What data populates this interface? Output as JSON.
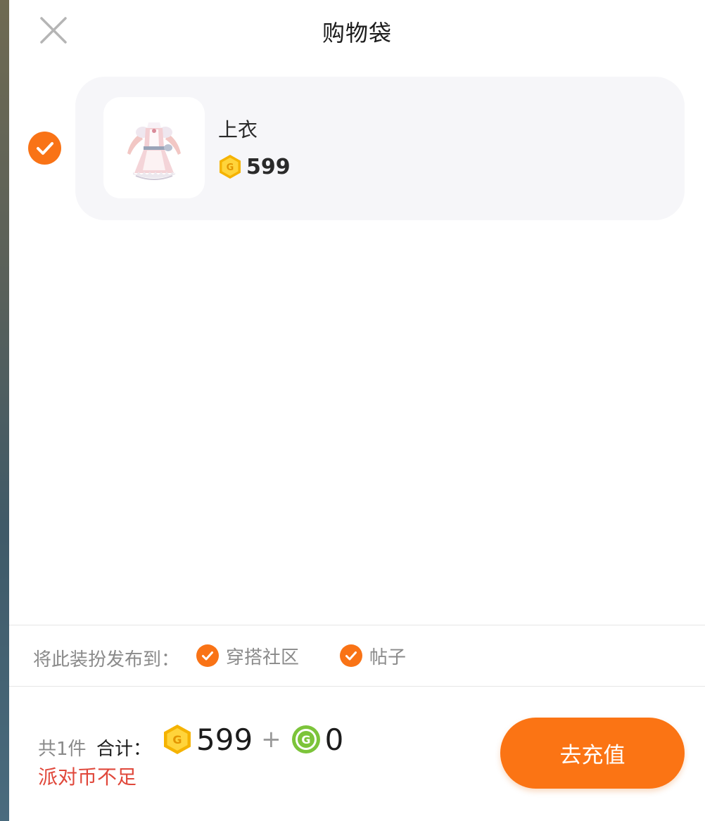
{
  "header": {
    "title": "购物袋",
    "close_icon": "close-icon"
  },
  "cart": {
    "items": [
      {
        "selected": true,
        "name": "上衣",
        "price": "599",
        "currency_icon": "gold-coin-icon",
        "thumbnail": "maid-dress-outfit"
      }
    ]
  },
  "publish": {
    "label": "将此装扮发布到：",
    "options": [
      {
        "label": "穿搭社区",
        "checked": true
      },
      {
        "label": "帖子",
        "checked": true
      }
    ]
  },
  "footer": {
    "count_label": "共1件",
    "total_label": "合计：",
    "gold_total": "599",
    "plus": "+",
    "green_total": "0",
    "warning": "派对币不足",
    "button_label": "去充值"
  },
  "colors": {
    "accent": "#f97316",
    "button": "#fb7414",
    "warning": "#e0483b",
    "gold_coin": "#f5b301",
    "green_coin": "#7cc43a"
  }
}
